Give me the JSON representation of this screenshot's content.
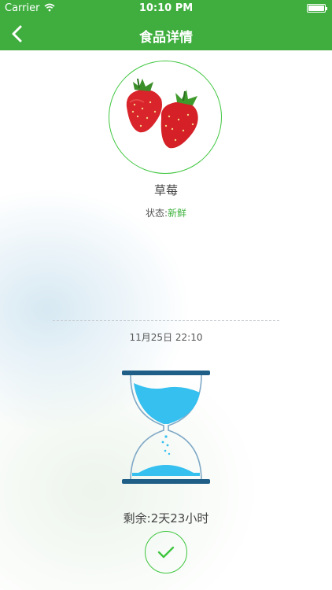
{
  "status_bar": {
    "carrier": "Carrier",
    "time": "10:10 PM"
  },
  "nav": {
    "title": "食品详情",
    "back_icon": "chevron-left-icon"
  },
  "food": {
    "name": "草莓",
    "status_label": "状态:",
    "status_value": "新鲜",
    "image": "strawberry-image",
    "datetime": "11月25日 22:10",
    "remaining": "剩余:2天23小时"
  },
  "confirm_icon": "check-icon",
  "colors": {
    "brand": "#3fae3f",
    "accent_green": "#3fc63f",
    "sand_blue": "#35c0ef",
    "frame_dark": "#1f5e86"
  }
}
